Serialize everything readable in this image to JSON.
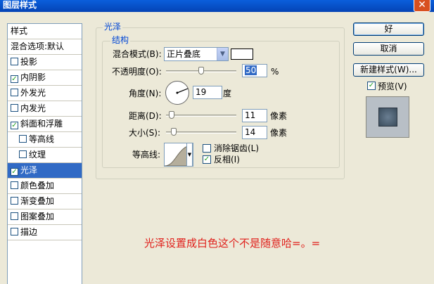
{
  "window": {
    "title": "图层样式",
    "close_glyph": "✕"
  },
  "style_list": {
    "header": "样式",
    "blend_default": "混合选项:默认",
    "items": [
      {
        "label": "投影",
        "checked": false,
        "sub": false,
        "selected": false
      },
      {
        "label": "内阴影",
        "checked": true,
        "sub": false,
        "selected": false
      },
      {
        "label": "外发光",
        "checked": false,
        "sub": false,
        "selected": false
      },
      {
        "label": "内发光",
        "checked": false,
        "sub": false,
        "selected": false
      },
      {
        "label": "斜面和浮雕",
        "checked": true,
        "sub": false,
        "selected": false
      },
      {
        "label": "等高线",
        "checked": false,
        "sub": true,
        "selected": false
      },
      {
        "label": "纹理",
        "checked": false,
        "sub": true,
        "selected": false
      },
      {
        "label": "光泽",
        "checked": true,
        "sub": false,
        "selected": true
      },
      {
        "label": "颜色叠加",
        "checked": false,
        "sub": false,
        "selected": false
      },
      {
        "label": "渐变叠加",
        "checked": false,
        "sub": false,
        "selected": false
      },
      {
        "label": "图案叠加",
        "checked": false,
        "sub": false,
        "selected": false
      },
      {
        "label": "描边",
        "checked": false,
        "sub": false,
        "selected": false
      }
    ]
  },
  "satin": {
    "section_title": "光泽",
    "structure_title": "结构",
    "blend_mode_label": "混合模式(B):",
    "blend_mode_value": "正片叠底",
    "color_value": "#ffffff",
    "opacity_label": "不透明度(O):",
    "opacity_value": "50",
    "opacity_unit": "%",
    "angle_label": "角度(N):",
    "angle_value": "19",
    "angle_unit": "度",
    "distance_label": "距离(D):",
    "distance_value": "11",
    "distance_unit": "像素",
    "size_label": "大小(S):",
    "size_value": "14",
    "size_unit": "像素",
    "contour_label": "等高线:",
    "anti_alias_label": "消除锯齿(L)",
    "anti_alias_checked": false,
    "invert_label": "反相(I)",
    "invert_checked": true
  },
  "buttons": {
    "ok": "好",
    "cancel": "取消",
    "new_style": "新建样式(W)...",
    "preview_label": "预览(V)",
    "preview_checked": true
  },
  "annotation": "光泽设置成白色这个不是随意哈=。="
}
